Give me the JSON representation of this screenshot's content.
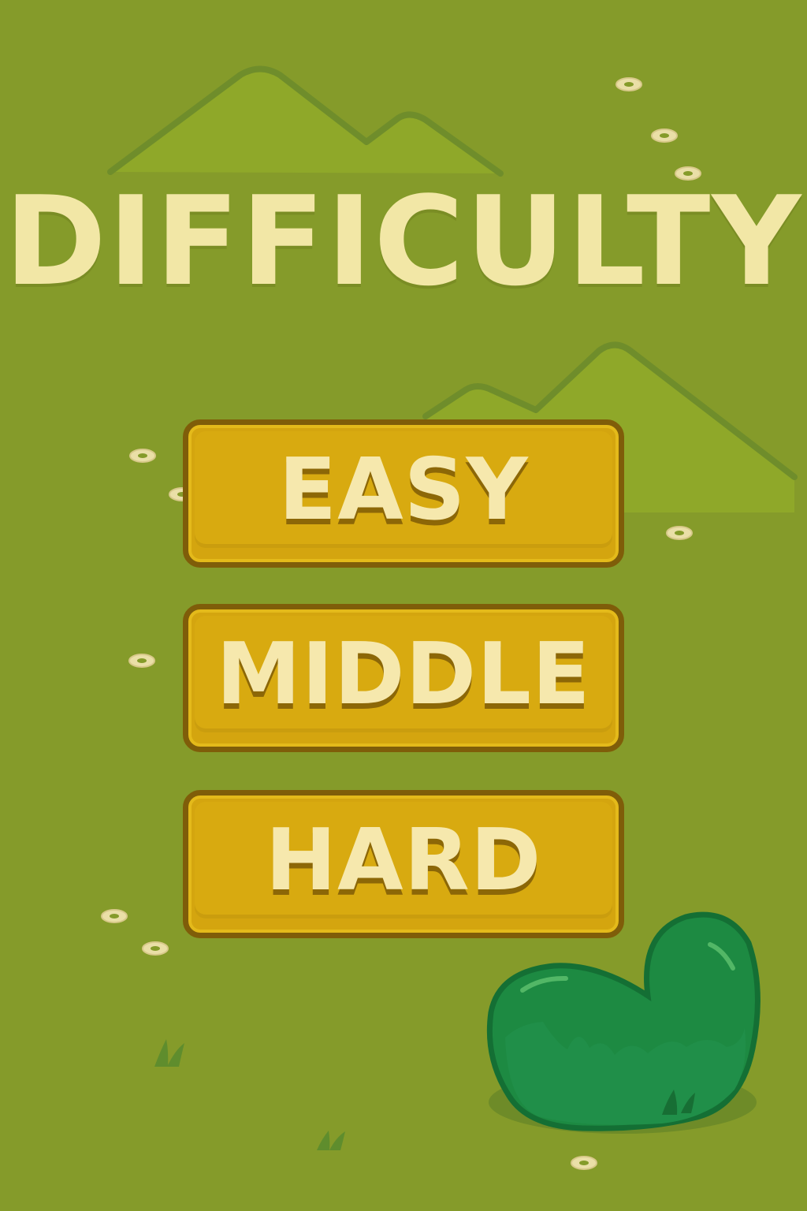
{
  "screen": {
    "title": "DIFFICULTY"
  },
  "buttons": [
    {
      "id": "easy",
      "label": "EASY"
    },
    {
      "id": "middle",
      "label": "MIDDLE"
    },
    {
      "id": "hard",
      "label": "HARD"
    }
  ],
  "theme": {
    "background": "#859b2a",
    "hill": "#96ac22",
    "button_fill": "#d4a50f",
    "button_border": "#7f5d09",
    "text": "#f2e7a6",
    "bush": "#1f8f43"
  }
}
